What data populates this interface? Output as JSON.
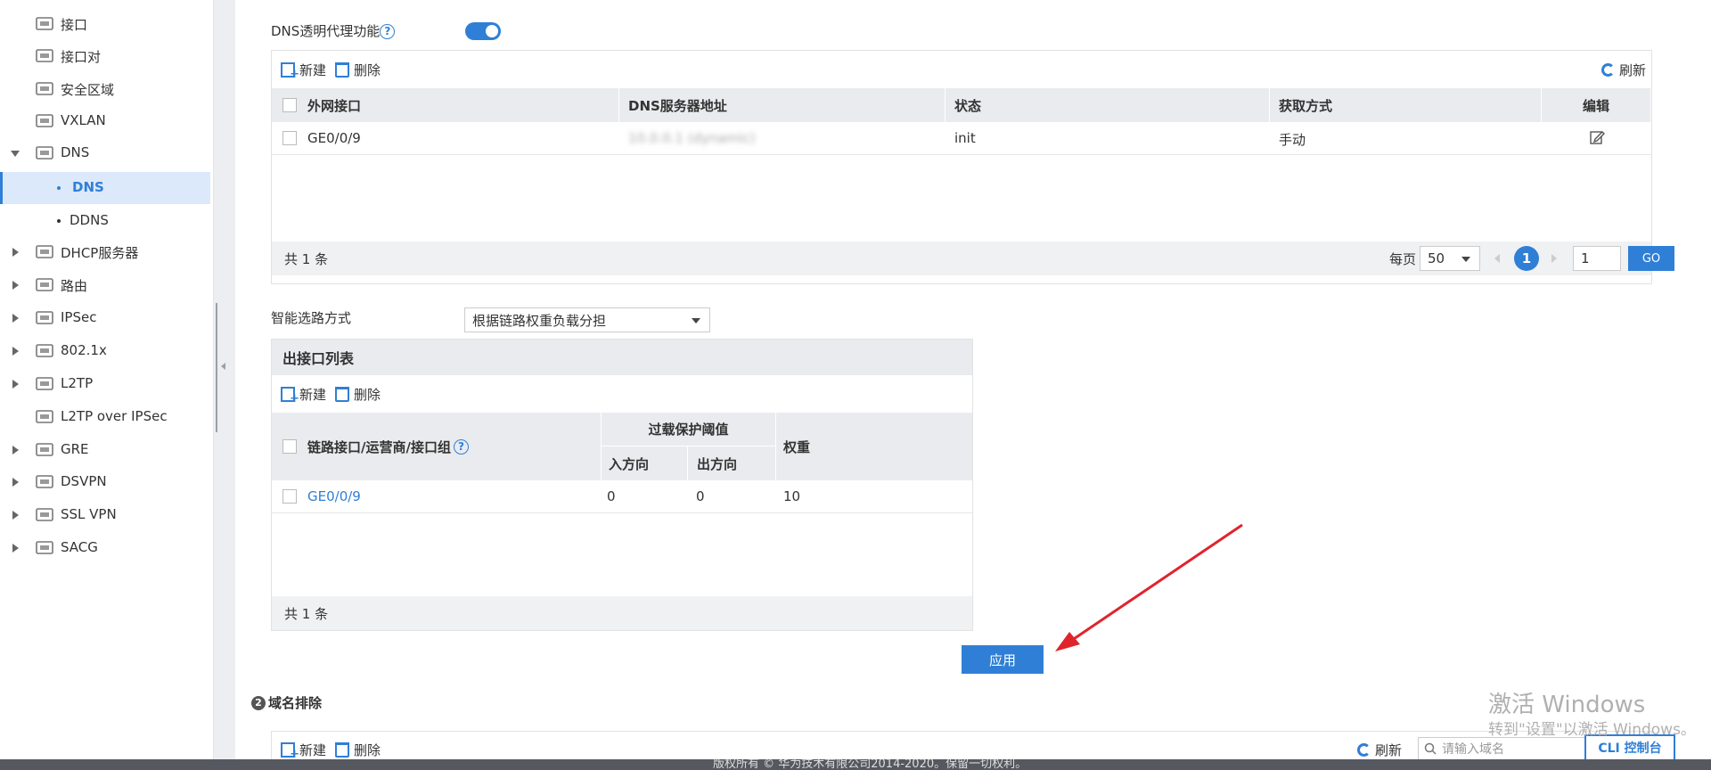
{
  "sidebar": {
    "items": [
      {
        "label": "接口",
        "icon": "interface-icon",
        "caret": "none",
        "sub": false
      },
      {
        "label": "接口对",
        "icon": "interface-pair-icon",
        "caret": "none",
        "sub": false
      },
      {
        "label": "安全区域",
        "icon": "security-zone-icon",
        "caret": "none",
        "sub": false
      },
      {
        "label": "VXLAN",
        "icon": "vxlan-icon",
        "caret": "none",
        "sub": false
      },
      {
        "label": "DNS",
        "icon": "dns-icon",
        "caret": "down",
        "sub": false
      },
      {
        "label": "DNS",
        "icon": "",
        "caret": "none",
        "sub": true,
        "active": true
      },
      {
        "label": "DDNS",
        "icon": "",
        "caret": "none",
        "sub": true
      },
      {
        "label": "DHCP服务器",
        "icon": "dhcp-server-icon",
        "caret": "right",
        "sub": false
      },
      {
        "label": "路由",
        "icon": "route-icon",
        "caret": "right",
        "sub": false
      },
      {
        "label": "IPSec",
        "icon": "ipsec-icon",
        "caret": "right",
        "sub": false
      },
      {
        "label": "802.1x",
        "icon": "8021x-icon",
        "caret": "right",
        "sub": false
      },
      {
        "label": "L2TP",
        "icon": "l2tp-icon",
        "caret": "right",
        "sub": false
      },
      {
        "label": "L2TP over IPSec",
        "icon": "l2tp-ipsec-icon",
        "caret": "none",
        "sub": false
      },
      {
        "label": "GRE",
        "icon": "gre-icon",
        "caret": "right",
        "sub": false
      },
      {
        "label": "DSVPN",
        "icon": "dsvpn-icon",
        "caret": "right",
        "sub": false
      },
      {
        "label": "SSL VPN",
        "icon": "ssl-vpn-icon",
        "caret": "right",
        "sub": false
      },
      {
        "label": "SACG",
        "icon": "sacg-icon",
        "caret": "right",
        "sub": false
      }
    ]
  },
  "dns_proxy": {
    "label": "DNS透明代理功能",
    "help": "?",
    "enabled": true
  },
  "dns_table": {
    "toolbar": {
      "new": "新建",
      "delete": "删除",
      "refresh": "刷新"
    },
    "columns": [
      "外网接口",
      "DNS服务器地址",
      "状态",
      "获取方式",
      "编辑"
    ],
    "rows": [
      {
        "interface": "GE0/0/9",
        "server": "10.0.0.1 (dynamic)",
        "status": "init",
        "method": "手动"
      }
    ],
    "footer": {
      "total": "共 1 条",
      "per_page_label": "每页",
      "per_page": "50",
      "current_page": "1",
      "page_input": "1",
      "go": "GO"
    }
  },
  "smart_route": {
    "label": "智能选路方式",
    "value": "根据链路权重负载分担"
  },
  "out_if_list": {
    "title": "出接口列表",
    "toolbar": {
      "new": "新建",
      "delete": "删除"
    },
    "columns": {
      "link": "链路接口/运营商/接口组",
      "overload": "过载保护阈值",
      "in": "入方向",
      "out": "出方向",
      "weight": "权重"
    },
    "rows": [
      {
        "link": "GE0/0/9",
        "in": "0",
        "out": "0",
        "weight": "10"
      }
    ],
    "footer": {
      "total": "共 1 条"
    }
  },
  "apply_button": "应用",
  "domain_exclude": {
    "number": "2",
    "title": "域名排除",
    "toolbar": {
      "new": "新建",
      "delete": "删除",
      "refresh": "刷新"
    },
    "search_placeholder": "请输入域名",
    "cli": "CLI 控制台"
  },
  "watermark": {
    "line1": "激活 Windows",
    "line2": "转到\"设置\"以激活 Windows。"
  },
  "copyright": "版权所有 © 华为技术有限公司2014-2020。保留一切权利。",
  "colors": {
    "accent": "#2f7fd6",
    "annotation": "#e0242c"
  }
}
